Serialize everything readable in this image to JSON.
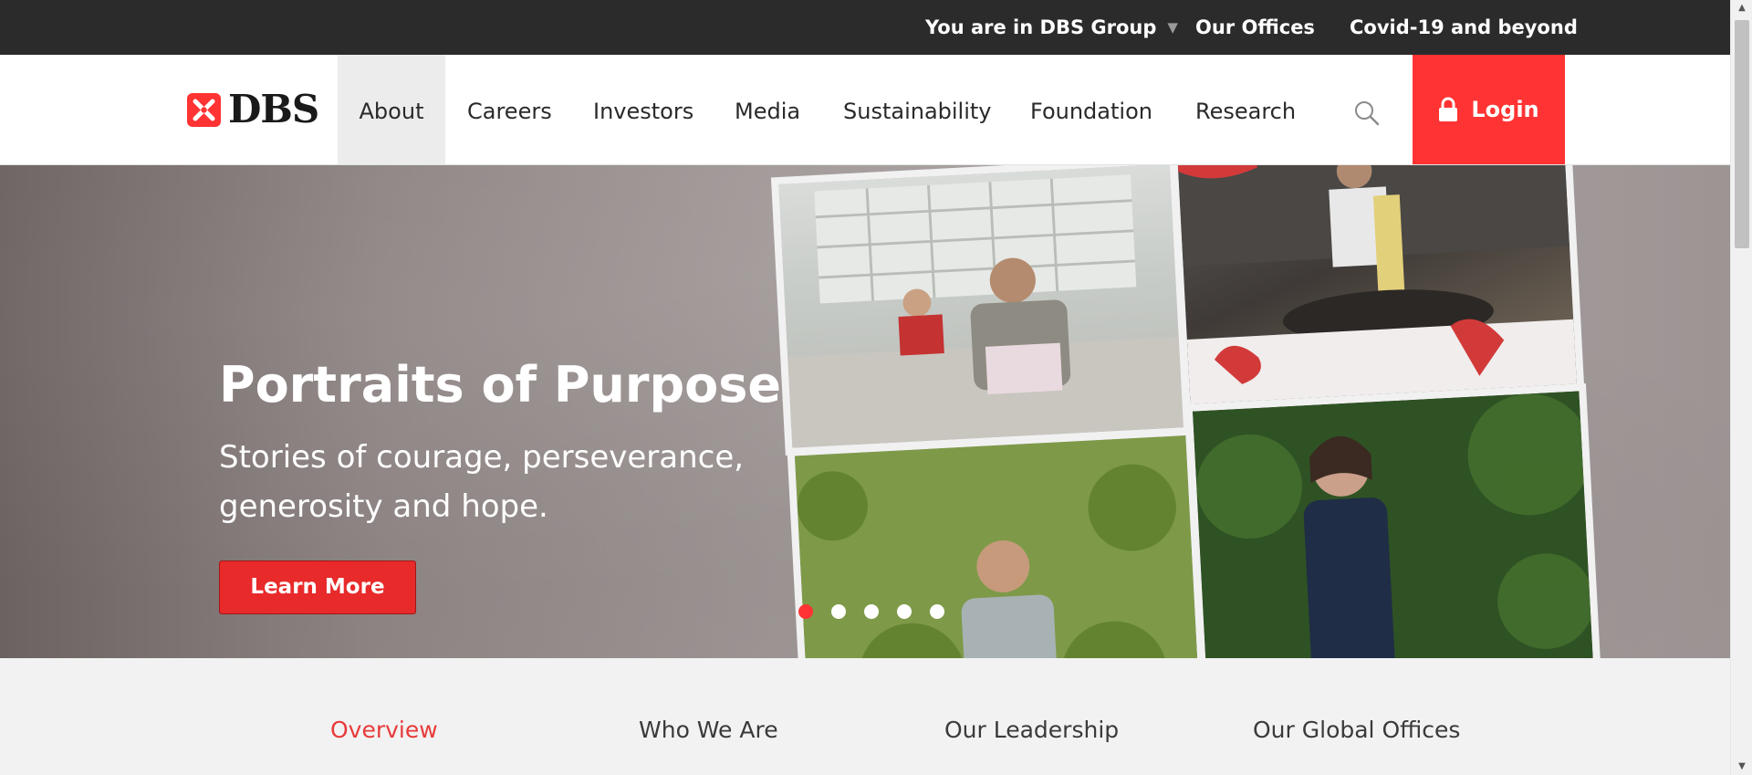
{
  "topbar": {
    "group_label": "You are in DBS Group",
    "offices_label": "Our Offices",
    "covid_label": "Covid-19 and beyond"
  },
  "nav": {
    "logo_text": "DBS",
    "items": [
      "About",
      "Careers",
      "Investors",
      "Media",
      "Sustainability",
      "Foundation",
      "Research"
    ],
    "active": "About",
    "login_label": "Login"
  },
  "hero": {
    "title": "Portraits of Purpose",
    "subtitle": "Stories of courage, perseverance, generosity and hope.",
    "button_label": "Learn More",
    "slide_count": 5,
    "active_slide": 1
  },
  "subnav": {
    "tabs": [
      "Overview",
      "Who We Are",
      "Our Leadership",
      "Our Global Offices"
    ],
    "active": "Overview"
  },
  "icons": {
    "search": "search-icon",
    "lock": "lock-icon",
    "caret": "caret-down-icon"
  },
  "colors": {
    "brand_red": "#ff3333",
    "topbar_bg": "#2b2b2b",
    "subnav_bg": "#f2f2f2"
  }
}
